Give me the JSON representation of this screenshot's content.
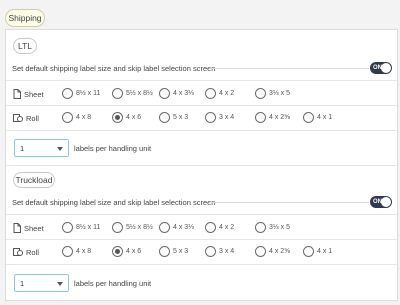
{
  "tab": {
    "label": "Shipping"
  },
  "sections": [
    {
      "title": "LTL",
      "setting_text": "Set default shipping label size and skip label selection screen",
      "toggle_text": "ON",
      "sheet": {
        "label": "Sheet",
        "options": [
          "8½ x 11",
          "5½ x 8½",
          "4 x 3⅓",
          "4 x 2",
          "3⅓ x 5"
        ],
        "selected": null
      },
      "roll": {
        "label": "Roll",
        "options": [
          "4 x 8",
          "4 x 6",
          "5 x 3",
          "3 x 4",
          "4 x 2⅝",
          "4 x 1"
        ],
        "selected": "4 x 6"
      },
      "quantity": {
        "value": "1",
        "suffix": "labels per handling unit"
      }
    },
    {
      "title": "Truckload",
      "setting_text": "Set default shipping label size and skip label selection screen",
      "toggle_text": "ON",
      "sheet": {
        "label": "Sheet",
        "options": [
          "8½ x 11",
          "5½ x 8½",
          "4 x 3⅓",
          "4 x 2",
          "3⅓ x 5"
        ],
        "selected": null
      },
      "roll": {
        "label": "Roll",
        "options": [
          "4 x 8",
          "4 x 6",
          "5 x 3",
          "3 x 4",
          "4 x 2⅝",
          "4 x 1"
        ],
        "selected": "4 x 6"
      },
      "quantity": {
        "value": "1",
        "suffix": "labels per handling unit"
      }
    }
  ]
}
